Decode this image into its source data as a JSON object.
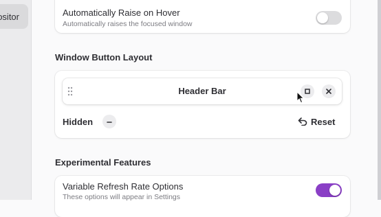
{
  "sidebar": {
    "active_item_label": "ositor"
  },
  "auto_raise": {
    "title": "Automatically Raise on Hover",
    "subtitle": "Automatically raises the focused window",
    "enabled": false
  },
  "window_button_layout": {
    "section_title": "Window Button Layout",
    "header_bar_label": "Header Bar",
    "hidden_label": "Hidden",
    "reset_label": "Reset",
    "header_buttons": [
      "maximize-icon",
      "close-icon"
    ],
    "hidden_buttons": [
      "minimize-icon"
    ]
  },
  "experimental": {
    "section_title": "Experimental Features",
    "vrr_title": "Variable Refresh Rate Options",
    "vrr_subtitle": "These options will appear in Settings",
    "vrr_enabled": true
  },
  "colors": {
    "accent": "#8a3fc6",
    "switch_off": "#dcdcde"
  }
}
